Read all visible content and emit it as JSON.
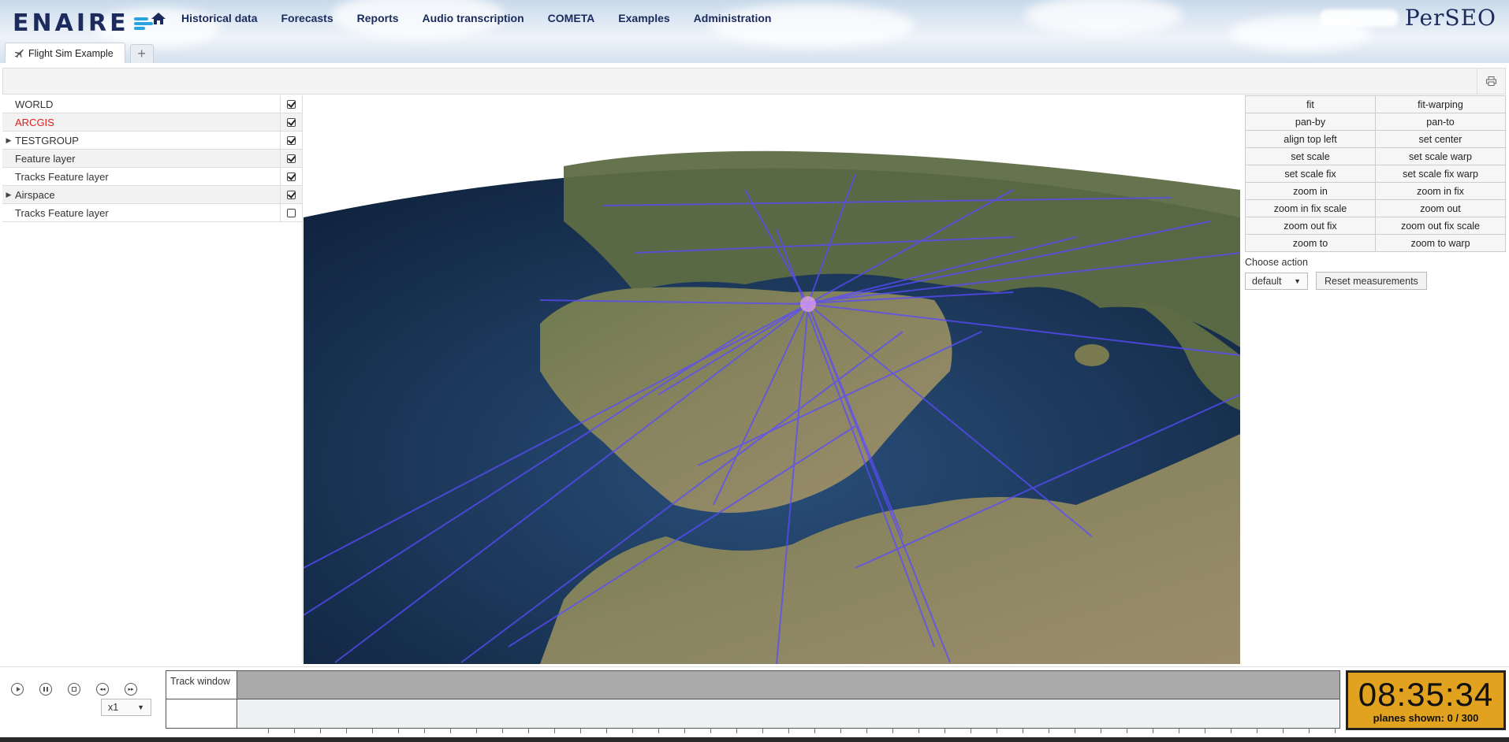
{
  "brand": {
    "logo_text": "ENAIRE",
    "product": "PerSEO"
  },
  "nav": {
    "home_icon": "home-icon",
    "items": [
      "Historical data",
      "Forecasts",
      "Reports",
      "Audio transcription",
      "COMETA",
      "Examples",
      "Administration"
    ]
  },
  "tabs": [
    {
      "label": "Flight Sim Example",
      "icon": "plane-icon"
    }
  ],
  "tab_add_label": "+",
  "toolbar": {
    "print_icon": "print-icon"
  },
  "layers": [
    {
      "label": "WORLD",
      "expandable": false,
      "checked": true,
      "highlight": false
    },
    {
      "label": "ARCGIS",
      "expandable": false,
      "checked": true,
      "highlight": true
    },
    {
      "label": "TESTGROUP",
      "expandable": true,
      "checked": true,
      "highlight": false
    },
    {
      "label": "Feature layer",
      "expandable": false,
      "checked": true,
      "highlight": false
    },
    {
      "label": "Tracks Feature layer",
      "expandable": false,
      "checked": true,
      "highlight": false
    },
    {
      "label": "Airspace",
      "expandable": true,
      "checked": true,
      "highlight": false
    },
    {
      "label": "Tracks Feature layer",
      "expandable": false,
      "checked": false,
      "highlight": false
    }
  ],
  "controls": {
    "buttons": [
      "fit",
      "fit-warping",
      "pan-by",
      "pan-to",
      "align top left",
      "set center",
      "set scale",
      "set scale warp",
      "set scale fix",
      "set scale fix warp",
      "zoom in",
      "zoom in fix",
      "zoom in fix scale",
      "zoom out",
      "zoom out fix",
      "zoom out fix scale",
      "zoom to",
      "zoom to warp"
    ],
    "choose_action_label": "Choose action",
    "action_selected": "default",
    "reset_label": "Reset measurements"
  },
  "playback": {
    "speed": "x1",
    "track_window_label": "Track window",
    "clock": "08:35:34",
    "planes_shown": "planes shown: 0 / 300"
  },
  "colors": {
    "accent_clock": "#e0a21f",
    "highlight_layer": "#e02020",
    "track_line": "#5a4bff"
  }
}
